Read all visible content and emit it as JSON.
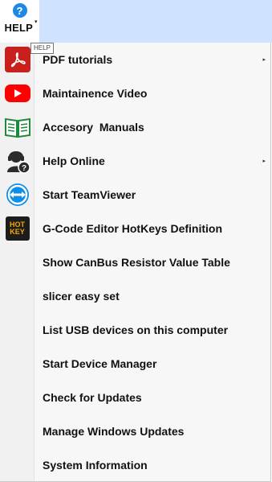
{
  "ribbon": {
    "help_button": {
      "icon": "question-circle-icon",
      "label": "HELP",
      "accent": "#1e88e5"
    },
    "strip_color": "#cfe3ff"
  },
  "tooltip": {
    "text": "HELP"
  },
  "menu": {
    "items": [
      {
        "label": "PDF tutorials",
        "icon": "pdf-icon",
        "has_submenu": true
      },
      {
        "label": "Maintainence Video",
        "icon": "youtube-icon",
        "has_submenu": false
      },
      {
        "label": "Accesory  Manuals",
        "icon": "manual-book-icon",
        "has_submenu": false
      },
      {
        "label": "Help Online",
        "icon": "support-agent-icon",
        "has_submenu": true
      },
      {
        "label": "Start TeamViewer",
        "icon": "teamviewer-icon",
        "has_submenu": false
      },
      {
        "label": "G-Code Editor HotKeys Definition",
        "icon": "hotkey-icon",
        "icon_text": [
          "HOT",
          "KEY"
        ],
        "has_submenu": false
      },
      {
        "label": "Show CanBus Resistor Value Table",
        "icon": "",
        "has_submenu": false
      },
      {
        "label": "slicer easy set",
        "icon": "",
        "has_submenu": false
      },
      {
        "label": "List USB devices on this computer",
        "icon": "",
        "has_submenu": false
      },
      {
        "label": "Start Device Manager",
        "icon": "",
        "has_submenu": false
      },
      {
        "label": "Check for Updates",
        "icon": "",
        "has_submenu": false
      },
      {
        "label": "Manage Windows Updates",
        "icon": "",
        "has_submenu": false
      },
      {
        "label": "System Information",
        "icon": "",
        "has_submenu": false
      }
    ],
    "submenu_arrow": "▸"
  },
  "colors": {
    "pdf_red": "#c8201c",
    "youtube_red": "#ff0000",
    "manual_green": "#1f8a3b",
    "teamviewer_blue": "#0e8ee9",
    "hotkey_orange": "#f2a900"
  }
}
